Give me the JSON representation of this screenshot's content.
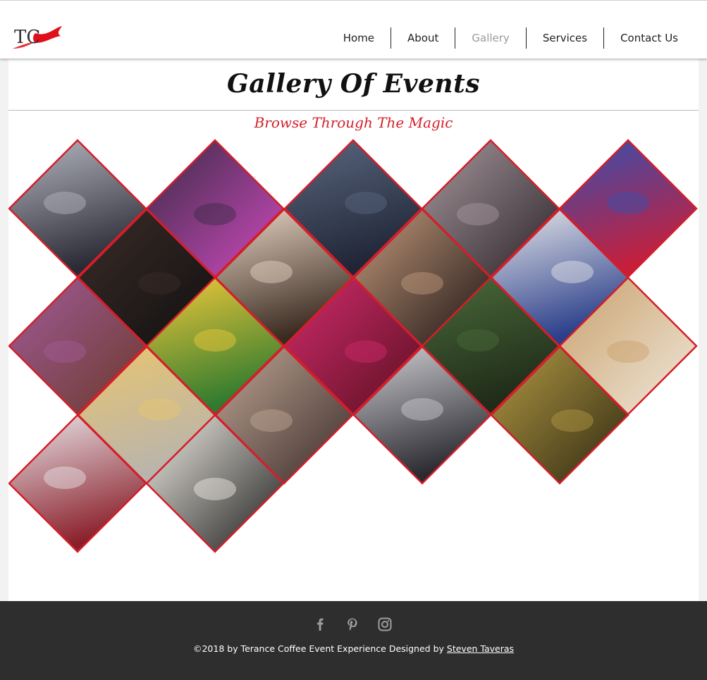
{
  "nav": {
    "items": [
      {
        "label": "Home",
        "active": false
      },
      {
        "label": "About",
        "active": false
      },
      {
        "label": "Gallery",
        "active": true
      },
      {
        "label": "Services",
        "active": false
      },
      {
        "label": "Contact Us",
        "active": false
      }
    ]
  },
  "logo": {
    "text": "TC"
  },
  "page": {
    "title": "Gallery Of Events",
    "subtitle": "Browse Through The Magic"
  },
  "gallery": {
    "frame_color": "#d41e2a",
    "tiles": [
      {
        "theme": "white-floral-ballroom",
        "c1": "#b7b9c2",
        "c2": "#2a2a35"
      },
      {
        "theme": "stage-purple",
        "c1": "#3a2a45",
        "c2": "#d04bbf"
      },
      {
        "theme": "convention-hall",
        "c1": "#5b6780",
        "c2": "#1f2535"
      },
      {
        "theme": "fashion-rack",
        "c1": "#a89aa0",
        "c2": "#2a2226"
      },
      {
        "theme": "blue-red-balcony",
        "c1": "#3650b0",
        "c2": "#c81e3a"
      },
      {
        "theme": "dark-audience",
        "c1": "#3b2c28",
        "c2": "#101010"
      },
      {
        "theme": "makeup-artist",
        "c1": "#e9d8c6",
        "c2": "#3a2a20"
      },
      {
        "theme": "gown-couple",
        "c1": "#c49b7c",
        "c2": "#1c1414"
      },
      {
        "theme": "wedding-dress",
        "c1": "#e8e8ea",
        "c2": "#2a3e8a"
      },
      {
        "theme": "purple-centerpiece",
        "c1": "#a15b9a",
        "c2": "#6b3a2a"
      },
      {
        "theme": "colorful-flowers",
        "c1": "#f2c93a",
        "c2": "#2f7a2f"
      },
      {
        "theme": "pink-bouquet",
        "c1": "#d12b6d",
        "c2": "#5a1020"
      },
      {
        "theme": "green-plants",
        "c1": "#4a6a3a",
        "c2": "#1f2a18"
      },
      {
        "theme": "place-settings",
        "c1": "#c9a06b",
        "c2": "#f0e9dd"
      },
      {
        "theme": "champagne-glasses",
        "c1": "#e8c56e",
        "c2": "#b9b4ad"
      },
      {
        "theme": "banquet-crowd",
        "c1": "#c1a895",
        "c2": "#3a2a2a"
      },
      {
        "theme": "dinner-crowd",
        "c1": "#d0cfd4",
        "c2": "#2a2a30"
      },
      {
        "theme": "ornate-hall",
        "c1": "#b39a45",
        "c2": "#2f2810"
      },
      {
        "theme": "banquet-tables",
        "c1": "#e9e7ea",
        "c2": "#8a1f2a"
      },
      {
        "theme": "candy-land-sign",
        "c1": "#f4f0e8",
        "c2": "#1a1a1a"
      }
    ]
  },
  "footer": {
    "social": [
      {
        "icon": "facebook-icon"
      },
      {
        "icon": "pinterest-icon"
      },
      {
        "icon": "instagram-icon"
      }
    ],
    "copyright_prefix": "©2018 by Terance Coffee Event Experience Designed by ",
    "designer": "Steven Taveras",
    "text_color": "#ffffff",
    "icon_color": "#9e9e9e"
  }
}
